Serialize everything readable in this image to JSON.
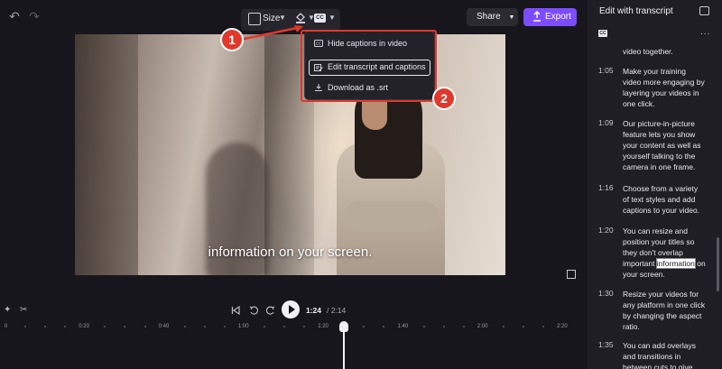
{
  "toolbar": {
    "undo_icon": "undo-icon",
    "redo_icon": "redo-icon",
    "size_label": "Size",
    "share_label": "Share",
    "export_label": "Export",
    "accent_color": "#7c4dff"
  },
  "caption_menu": {
    "items": [
      {
        "label": "Hide captions in video",
        "icon": "cc-icon"
      },
      {
        "label": "Edit transcript and captions",
        "icon": "edit-transcript-icon",
        "selected": true
      },
      {
        "label": "Download as .srt",
        "icon": "download-icon"
      }
    ],
    "annotation_color": "#e0382b"
  },
  "annotations": {
    "badge1": "1",
    "badge2": "2"
  },
  "video": {
    "caption": "information on your screen."
  },
  "panel": {
    "title": "Edit with transcript",
    "more_label": "...",
    "entries": [
      {
        "time": "1:05",
        "text": "Make your training video  more engaging by layering your videos in one click."
      },
      {
        "time": "1:09",
        "text": "Our picture-in-picture feature lets you show your content as well as yourself talking to the camera in one frame."
      },
      {
        "time": "1:16",
        "text": "Choose from a variety of  text styles and add captions to your video."
      },
      {
        "time": "1:20",
        "text_before": "You can resize and position your titles so they don't overlap important ",
        "highlight": "information",
        "text_after": " on your screen."
      },
      {
        "time": "1:30",
        "text": "Resize your videos for any platform in one click  by changing the aspect ratio."
      },
      {
        "time": "1:35",
        "text": "You can add overlays and transitions in between cuts to give"
      }
    ],
    "partial_top": "video together."
  },
  "timeline": {
    "current_time": "1:24",
    "total_time": "/ 2:14",
    "ticks": [
      "0",
      "0:20",
      "0:40",
      "1:00",
      "1:20",
      "1:40",
      "2:00",
      "2:20"
    ]
  }
}
